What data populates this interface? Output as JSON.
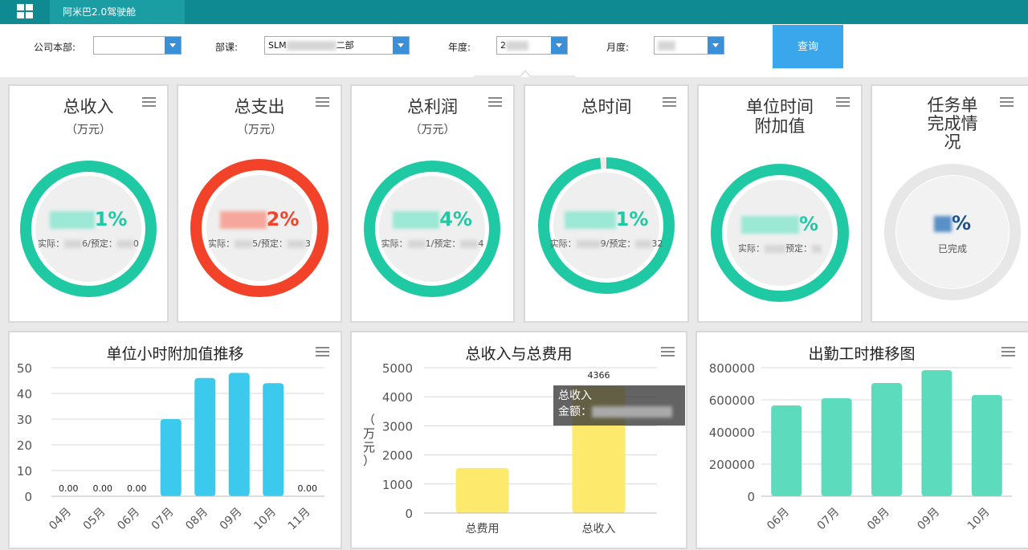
{
  "app": {
    "tab_title": "阿米巴2.0驾驶舱"
  },
  "filters": {
    "company_label": "公司本部:",
    "company_value": "",
    "dept_label": "部课:",
    "dept_value_prefix": "SLM",
    "dept_value_suffix": "二部",
    "year_label": "年度:",
    "year_value": "2",
    "month_label": "月度:",
    "month_value": "",
    "query_label": "查询"
  },
  "kpis": [
    {
      "title": "总收入",
      "unit": "（万元）",
      "percent_suffix": "1%",
      "detail_a": "实际：",
      "detail_b": "6/预定：",
      "detail_c": "0",
      "color": "#1ec9a3",
      "fill": 1.0
    },
    {
      "title": "总支出",
      "unit": "（万元）",
      "percent_suffix": "2%",
      "detail_a": "实际：",
      "detail_b": "5/预定：",
      "detail_c": "3",
      "color": "#f2432a",
      "fill": 1.0
    },
    {
      "title": "总利润",
      "unit": "（万元）",
      "percent_suffix": "4%",
      "detail_a": "实际：",
      "detail_b": "1/预定：",
      "detail_c": "4",
      "color": "#1ec9a3",
      "fill": 1.0
    },
    {
      "title": "总时间",
      "unit": "",
      "percent_suffix": "1%",
      "detail_a": "实际：",
      "detail_b": "9/预定：",
      "detail_c": "32",
      "color": "#1ec9a3",
      "fill": 0.985
    },
    {
      "title_line1": "单位时间",
      "title_line2": "附加值",
      "percent_suffix": "%",
      "detail_a": "实际：",
      "detail_b": "预定：",
      "color": "#1ec9a3",
      "fill": 1.0
    },
    {
      "title_line1": "任务单",
      "title_line2": "完成情",
      "title_line3": "况",
      "percent_suffix": "%",
      "status": "已完成",
      "color": "#1d4f8c",
      "fill": 0.0
    }
  ],
  "charts": {
    "hourly_value": {
      "title": "单位小时附加值推移"
    },
    "income_expense": {
      "title": "总收入与总费用",
      "ylabel": "（万元）",
      "tooltip_title": "总收入",
      "tooltip_label": "金额："
    },
    "attendance": {
      "title": "出勤工时推移图"
    }
  },
  "chart_data": [
    {
      "type": "bar",
      "title": "单位小时附加值推移",
      "categories": [
        "04月",
        "05月",
        "06月",
        "07月",
        "08月",
        "09月",
        "10月",
        "11月"
      ],
      "values": [
        0,
        0,
        0,
        30,
        46,
        48,
        44,
        0
      ],
      "data_labels": [
        "0.00",
        "0.00",
        "0.00",
        "",
        "",
        "",
        "",
        "0.00"
      ],
      "ylim": [
        0,
        50
      ],
      "yticks": [
        0,
        10,
        20,
        30,
        40,
        50
      ],
      "color": "#3cc9ee",
      "grid": true
    },
    {
      "type": "bar",
      "title": "总收入与总费用",
      "categories": [
        "总费用",
        "总收入"
      ],
      "values": [
        1550,
        4366
      ],
      "data_labels": [
        "",
        "4366"
      ],
      "ylabel": "（万元）",
      "ylim": [
        0,
        5000
      ],
      "yticks": [
        0,
        1000,
        2000,
        3000,
        4000,
        5000
      ],
      "color": "#fde96b",
      "grid": true
    },
    {
      "type": "bar",
      "title": "出勤工时推移图",
      "categories": [
        "06月",
        "07月",
        "08月",
        "09月",
        "10月"
      ],
      "values": [
        565000,
        610000,
        705000,
        785000,
        630000
      ],
      "ylim": [
        0,
        800000
      ],
      "yticks": [
        0,
        200000,
        400000,
        600000,
        800000
      ],
      "color": "#5cdcbd",
      "grid": true
    }
  ]
}
